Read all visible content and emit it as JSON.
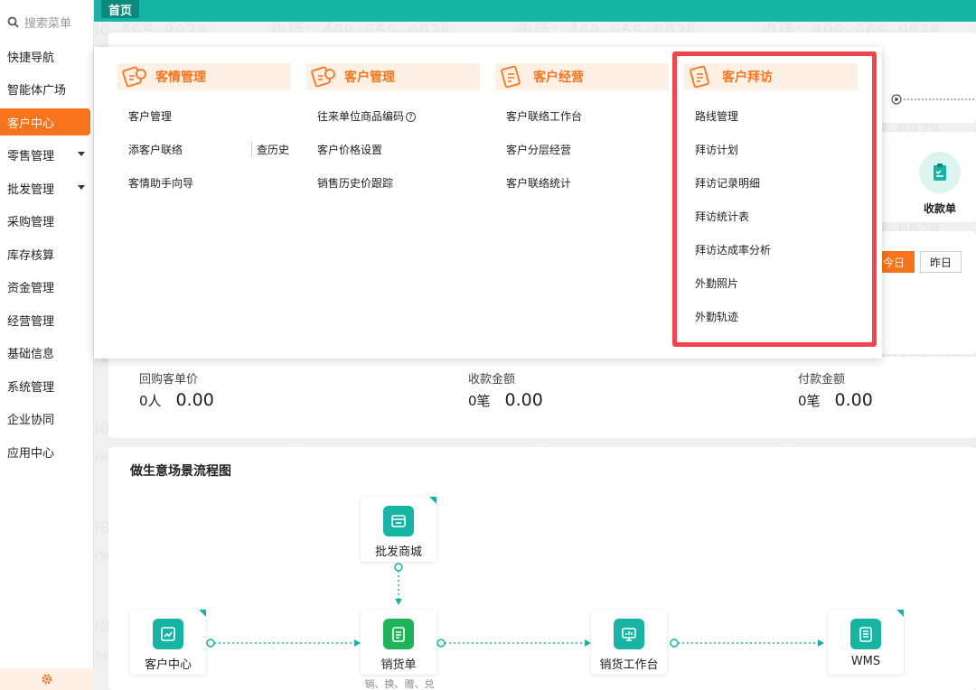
{
  "sidebar": {
    "search_placeholder": "搜索菜单",
    "items": [
      {
        "label": "快捷导航"
      },
      {
        "label": "智能体广场"
      },
      {
        "label": "客户中心"
      },
      {
        "label": "零售管理"
      },
      {
        "label": "批发管理"
      },
      {
        "label": "采购管理"
      },
      {
        "label": "库存核算"
      },
      {
        "label": "资金管理"
      },
      {
        "label": "经营管理"
      },
      {
        "label": "基础信息"
      },
      {
        "label": "系统管理"
      },
      {
        "label": "企业协同"
      },
      {
        "label": "应用中心"
      }
    ],
    "active_item": "客户中心"
  },
  "topbar": {
    "home_tab": "首页"
  },
  "watermark": {
    "phone": "电话：400-665-0028",
    "site": "网址：www.chanjet.net"
  },
  "menu": {
    "columns": [
      {
        "title": "客情管理",
        "items": [
          "客户管理",
          "添客户联络",
          "查历史",
          "客情助手向导"
        ]
      },
      {
        "title": "客户管理",
        "items": [
          "往来单位商品编码",
          "客户价格设置",
          "销售历史价跟踪"
        ]
      },
      {
        "title": "客户经营",
        "items": [
          "客户联络工作台",
          "客户分层经营",
          "客户联络统计"
        ]
      },
      {
        "title": "客户拜访",
        "items": [
          "路线管理",
          "拜访计划",
          "拜访记录明细",
          "拜访统计表",
          "拜访达成率分析",
          "外勤照片",
          "外勤轨迹"
        ]
      }
    ]
  },
  "background": {
    "receipt_label": "收款单",
    "date_today": "今日",
    "date_yesterday": "昨日"
  },
  "stats": [
    {
      "label": "回购客单价",
      "count": "0人",
      "amount": "0.00"
    },
    {
      "label": "收款金额",
      "count": "0笔",
      "amount": "0.00"
    },
    {
      "label": "付款金额",
      "count": "0笔",
      "amount": "0.00"
    }
  ],
  "flow": {
    "title": "做生意场景流程图",
    "nodes": [
      {
        "label": "批发商城"
      },
      {
        "label": "客户中心"
      },
      {
        "label": "销货单",
        "sub": "销、换、赠、兑"
      },
      {
        "label": "销货工作台"
      },
      {
        "label": "WMS"
      }
    ]
  },
  "colors": {
    "accent": "#f7741d",
    "teal": "#17b3a3",
    "highlight": "#f0454a"
  }
}
